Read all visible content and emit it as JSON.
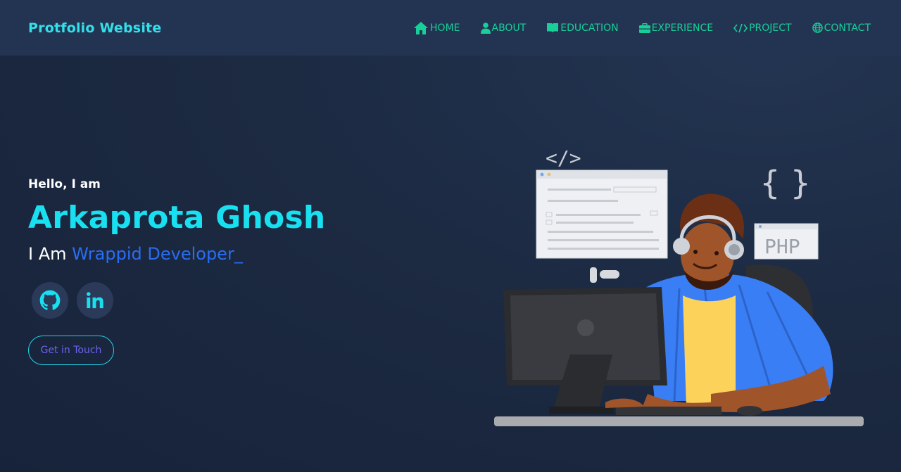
{
  "nav": {
    "brand": "Protfolio Website",
    "links": [
      {
        "label": "HOME",
        "icon": "home-icon"
      },
      {
        "label": "ABOUT",
        "icon": "user-icon"
      },
      {
        "label": "EDUCATION",
        "icon": "book-icon"
      },
      {
        "label": "EXPERIENCE",
        "icon": "briefcase-icon"
      },
      {
        "label": "PROJECT",
        "icon": "code-icon"
      },
      {
        "label": "CONTACT",
        "icon": "globe-icon"
      }
    ]
  },
  "hero": {
    "greeting": "Hello, I am",
    "name": "Arkaprota Ghosh",
    "role_prefix": "I Am",
    "role_typed": "Wrappid Developer",
    "cursor": "_",
    "socials": [
      {
        "icon": "github-icon"
      },
      {
        "icon": "linkedin-icon"
      }
    ],
    "cta_label": "Get in Touch"
  },
  "illustration": {
    "tag_label": "PHP",
    "code_symbol": "</>",
    "braces_symbol": "{ }"
  },
  "colors": {
    "accent_cyan": "#19e0f0",
    "nav_green": "#17cf97",
    "typed_blue": "#2a6df2",
    "cta_text": "#6d62f0",
    "navbar_bg": "#233453"
  }
}
